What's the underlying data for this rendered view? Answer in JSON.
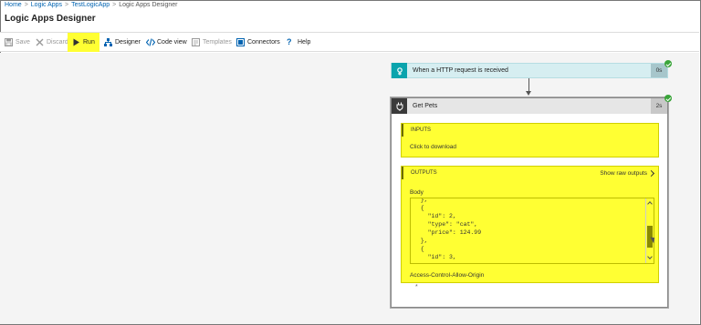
{
  "breadcrumb": {
    "items": [
      "Home",
      "Logic Apps",
      "TestLogicApp",
      "Logic Apps Designer"
    ],
    "separator": ">"
  },
  "page_title": "Logic Apps Designer",
  "toolbar": {
    "save": "Save",
    "discard": "Discard",
    "run": "Run",
    "designer": "Designer",
    "code_view": "Code view",
    "templates": "Templates",
    "connectors": "Connectors",
    "help": "Help"
  },
  "trigger": {
    "title": "When a HTTP request is received",
    "duration": "0s",
    "status": "succeeded"
  },
  "action": {
    "title": "Get Pets",
    "duration": "2s",
    "status": "succeeded",
    "inputs_header": "INPUTS",
    "inputs_link": "Click to download",
    "outputs_header": "OUTPUTS",
    "show_raw": "Show raw outputs",
    "body_label": "Body",
    "body_code": "  },\n  {\n    \"id\": 2,\n    \"type\": \"cat\",\n    \"price\": 124.99\n  },\n  {\n    \"id\": 3,",
    "header_label": "Access-Control-Allow-Origin",
    "header_value": "*"
  },
  "colors": {
    "highlight": "#ffff33",
    "trigger_icon": "#0aa4ad",
    "success": "#3aa53a",
    "link": "#0063b1"
  }
}
